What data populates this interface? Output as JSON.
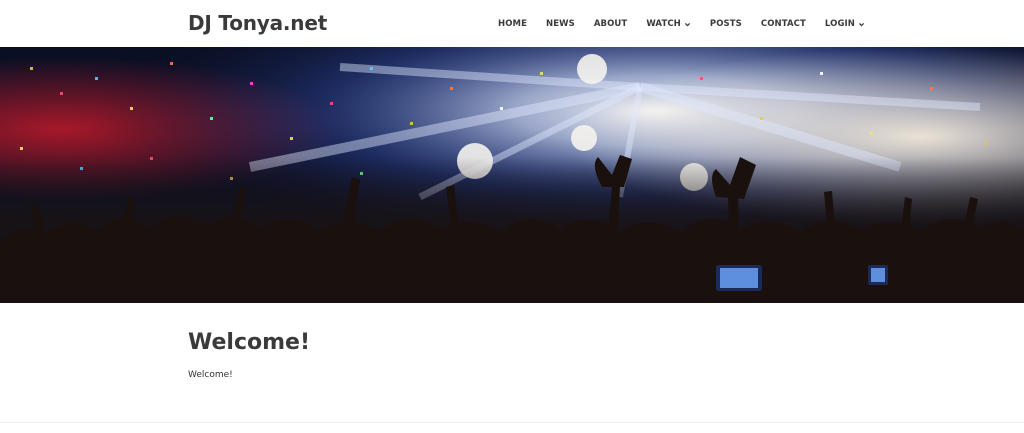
{
  "site": {
    "title": "DJ Tonya.net"
  },
  "nav": {
    "items": [
      {
        "label": "HOME",
        "has_dropdown": false
      },
      {
        "label": "NEWS",
        "has_dropdown": false
      },
      {
        "label": "ABOUT",
        "has_dropdown": false
      },
      {
        "label": "WATCH",
        "has_dropdown": true
      },
      {
        "label": "POSTS",
        "has_dropdown": false
      },
      {
        "label": "CONTACT",
        "has_dropdown": false
      },
      {
        "label": "LOGIN",
        "has_dropdown": true
      }
    ]
  },
  "hero": {
    "image": "concert-crowd-confetti-image"
  },
  "page": {
    "heading": "Welcome!",
    "body": "Welcome!"
  },
  "colors": {
    "text_dark": "#3a3a3a",
    "background": "#ffffff",
    "hero_dark": "#0b0f24"
  }
}
